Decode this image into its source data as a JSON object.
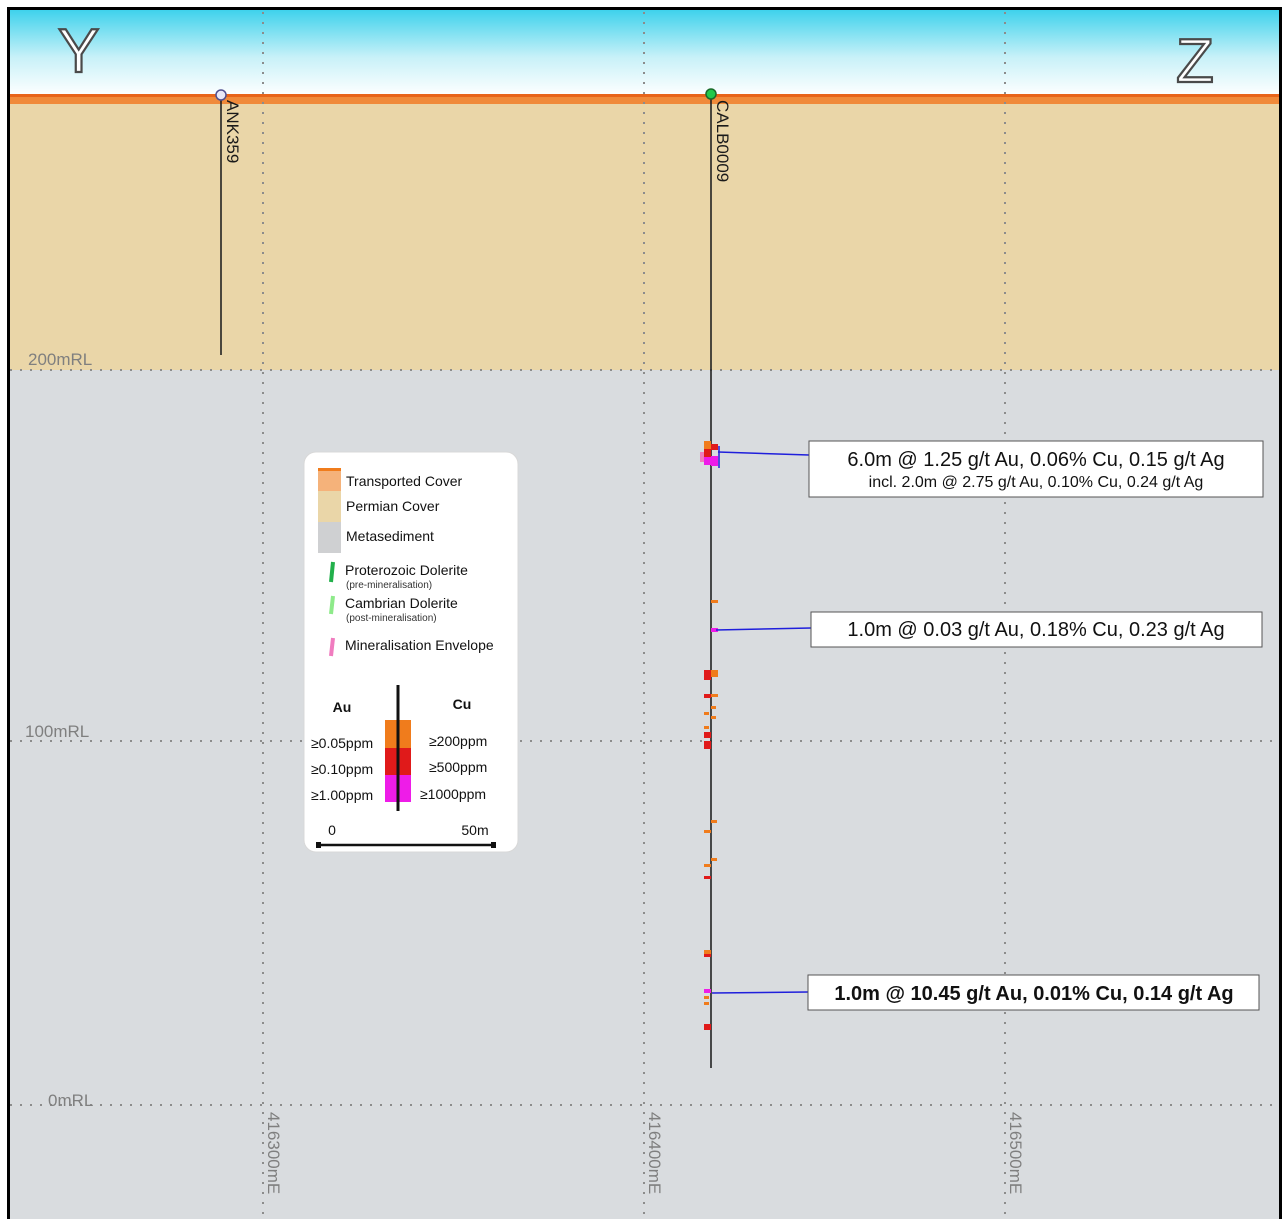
{
  "section_letters": {
    "left": "Y",
    "right": "Z"
  },
  "colors": {
    "sky_top": "#3fd2ec",
    "transported_cover": "#f08a3a",
    "permian_cover": "#ead6a8",
    "metasediment": "#d9dcdf",
    "proterozoic_dolerite": "#22b04b",
    "cambrian_dolerite": "#8eea8a",
    "mineralisation_envelope": "#f07cbf",
    "grade_low": "#f07c1c",
    "grade_mid": "#e01a1a",
    "grade_high": "#ee1ce8",
    "trace_line": "#1f1fdc"
  },
  "grid": {
    "rl_labels": [
      "200mRL",
      "100mRL",
      "0mRL"
    ],
    "easting_labels": [
      "416300mE",
      "416400mE",
      "416500mE"
    ]
  },
  "holes": [
    {
      "id": "ANK359"
    },
    {
      "id": "CALB0009"
    }
  ],
  "intercepts": [
    {
      "main": "6.0m @ 1.25 g/t Au, 0.06% Cu, 0.15 g/t Ag",
      "sub": "incl. 2.0m @ 2.75 g/t Au, 0.10% Cu, 0.24 g/t Ag",
      "bold": false
    },
    {
      "main": "1.0m @ 0.03 g/t Au, 0.18% Cu, 0.23 g/t Ag",
      "sub": "",
      "bold": false
    },
    {
      "main": "1.0m @ 10.45 g/t Au, 0.01% Cu, 0.14 g/t Ag",
      "sub": "",
      "bold": true
    }
  ],
  "legend": {
    "units": [
      {
        "label": "Transported Cover",
        "note": ""
      },
      {
        "label": "Permian Cover",
        "note": ""
      },
      {
        "label": "Metasediment",
        "note": ""
      },
      {
        "label": "Proterozoic Dolerite",
        "note": "(pre-mineralisation)"
      },
      {
        "label": "Cambrian Dolerite",
        "note": "(post-mineralisation)"
      },
      {
        "label": "Mineralisation Envelope",
        "note": ""
      }
    ],
    "au_heading": "Au",
    "cu_heading": "Cu",
    "au_thresholds": [
      "≥0.05ppm",
      "≥0.10ppm",
      "≥1.00ppm"
    ],
    "cu_thresholds": [
      "≥200ppm",
      "≥500ppm",
      "≥1000ppm"
    ],
    "scale_start": "0",
    "scale_end": "50m"
  }
}
